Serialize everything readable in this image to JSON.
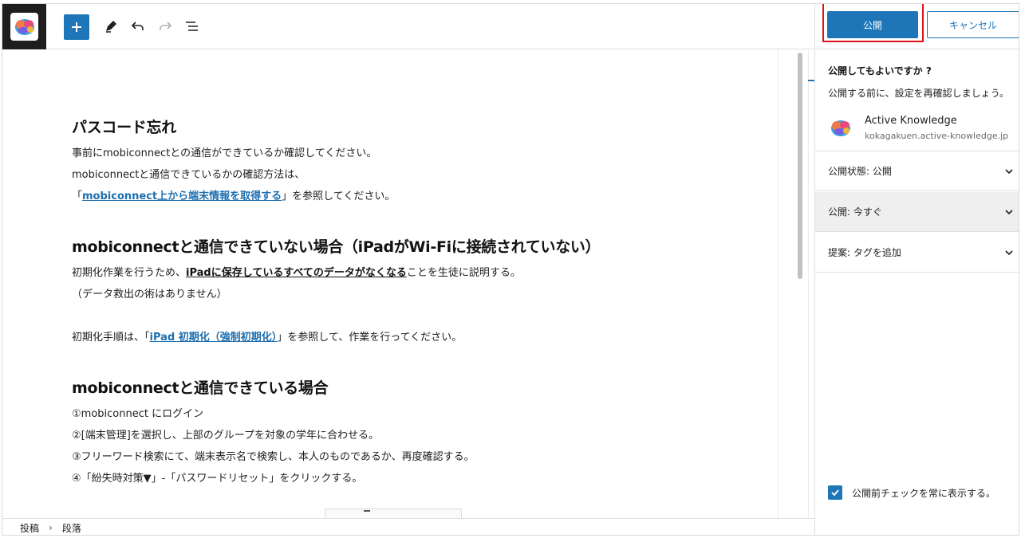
{
  "toolbar": {
    "add_icon": "plus-icon",
    "tools": [
      "pencil-icon",
      "undo-icon",
      "redo-icon",
      "list-view-icon"
    ]
  },
  "content": {
    "heading1": "パスコード忘れ",
    "p1": "事前にmobiconnectとの通信ができているか確認してください。",
    "p2": "mobiconnectと通信できているかの確認方法は、",
    "p3_pre": "「",
    "p3_link": "mobiconnect上から端末情報を取得する",
    "p3_post": "」を参照してください。",
    "heading2": "mobiconnectと通信できていない場合（iPadがWi-Fiに接続されていない）",
    "p4_pre": "初期化作業を行うため、",
    "p4_ul": "iPadに保存しているすべてのデータがなくなる",
    "p4_post": "ことを生徒に説明する。",
    "p5": "（データ救出の術はありません）",
    "p6_pre": "初期化手順は、「",
    "p6_link": "iPad  初期化（強制初期化）",
    "p6_post": "」を参照して、作業を行ってください。",
    "heading3": "mobiconnectと通信できている場合",
    "steps": [
      "①mobiconnect にログイン",
      "②[端末管理]を選択し、上部のグループを対象の学年に合わせる。",
      "③フリーワード検索にて、端末表示名で検索し、本人のものであるか、再度確認する。",
      "④「紛失時対策▼」-「パスワードリセット」をクリックする。"
    ]
  },
  "breadcrumb": {
    "item1": "投稿",
    "item2": "段落"
  },
  "panel": {
    "publish_label": "公開",
    "cancel_label": "キャンセル",
    "confirm_title": "公開してもよいですか ?",
    "confirm_desc": "公開する前に、設定を再確認しましょう。",
    "site_name": "Active Knowledge",
    "site_url": "kokagakuen.active-knowledge.jp",
    "rows": [
      {
        "label": "公開状態: 公開"
      },
      {
        "label": "公開: 今すぐ"
      },
      {
        "label": "提案: タグを追加"
      }
    ],
    "always_show_label": "公開前チェックを常に表示する。",
    "always_show_checked": true
  },
  "colors": {
    "accent": "#1e76b8",
    "highlight": "#e0101a"
  }
}
